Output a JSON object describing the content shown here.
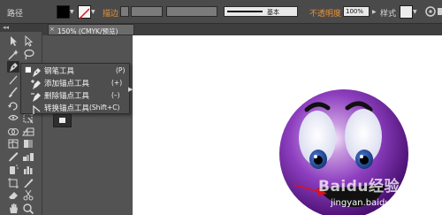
{
  "control_bar": {
    "object_label": "路径",
    "stroke_label": "描边",
    "brush_label": "基本",
    "opacity_label": "不透明度",
    "opacity_value": "100%",
    "style_label": "样式"
  },
  "document_tab": {
    "title": "150% (CMYK/预览)",
    "close": "×"
  },
  "tools_panel": {
    "collapse_arrows": "◂◂"
  },
  "pen_flyout": {
    "items": [
      {
        "label": "钢笔工具",
        "shortcut": "(P)",
        "selected": true,
        "icon": "pen-icon"
      },
      {
        "label": "添加锚点工具",
        "shortcut": "(+)",
        "selected": false,
        "icon": "add-anchor-point-icon"
      },
      {
        "label": "删除锚点工具",
        "shortcut": "(–)",
        "selected": false,
        "icon": "delete-anchor-point-icon"
      },
      {
        "label": "转换锚点工具",
        "shortcut": "(Shift+C)",
        "selected": false,
        "icon": "convert-anchor-point-icon"
      }
    ],
    "selected_marker": "■"
  },
  "watermark": {
    "brand": "Baidu经验",
    "url": "jingyan.baidu.com"
  },
  "colors": {
    "smiley_face": "#8e3fc0",
    "mouth": "#111111",
    "arrow": "#e0101a",
    "accent_orange": "#e8923a"
  }
}
